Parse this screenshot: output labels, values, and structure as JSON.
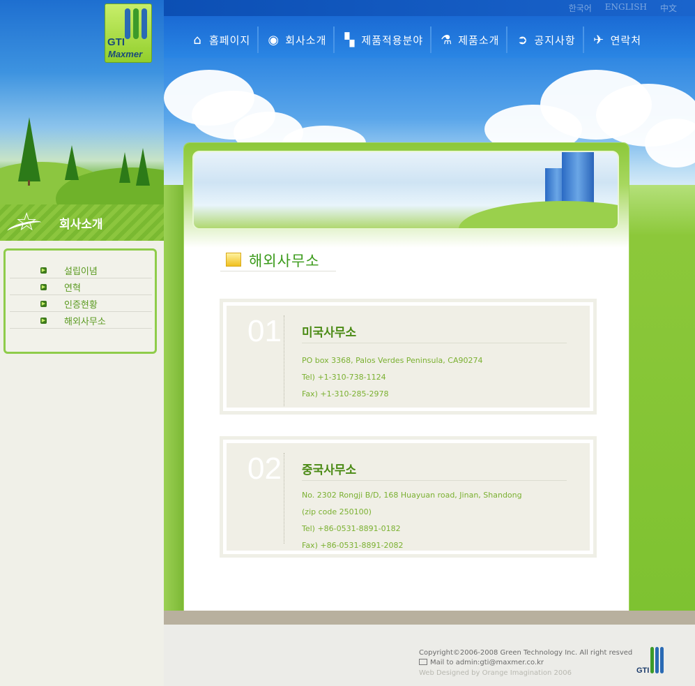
{
  "brand": {
    "logo_top": "GTI",
    "logo_bottom": "Maxmer",
    "footer_logo": "GTI"
  },
  "colors": {
    "accent_green": "#8cc63e",
    "title_green": "#3a9a1a",
    "nav_blue": "#1a6ad4"
  },
  "languages": [
    "한국어",
    "ENGLISH",
    "中文"
  ],
  "nav": [
    {
      "label": "홈페이지",
      "icon": "home-icon"
    },
    {
      "label": "회사소개",
      "icon": "eye-icon"
    },
    {
      "label": "제품적용분야",
      "icon": "blocks-icon"
    },
    {
      "label": "제품소개",
      "icon": "flask-icon"
    },
    {
      "label": "공지사항",
      "icon": "arrow-right-icon"
    },
    {
      "label": "연락처",
      "icon": "plane-icon"
    }
  ],
  "sidebar": {
    "section_title": "회사소개",
    "items": [
      "설립이념",
      "연혁",
      "인증현황",
      "해외사무소"
    ]
  },
  "page": {
    "title": "해외사무소"
  },
  "offices": [
    {
      "num": "01",
      "name": "미국사무소",
      "lines": [
        "PO box 3368, Palos Verdes Peninsula, CA90274",
        "Tel) +1-310-738-1124",
        "Fax) +1-310-285-2978"
      ]
    },
    {
      "num": "02",
      "name": "중국사무소",
      "lines": [
        "No. 2302 Rongji B/D, 168 Huayuan road, Jinan, Shandong",
        "(zip code 250100)",
        "Tel) +86-0531-8891-0182",
        "Fax) +86-0531-8891-2082"
      ]
    }
  ],
  "footer": {
    "copyright": "Copyright©2006-2008 Green Technology Inc. All right resved",
    "mail": "Mail to admin:gti@maxmer.co.kr",
    "designed": "Web Designed by Orange Imagination 2006"
  }
}
